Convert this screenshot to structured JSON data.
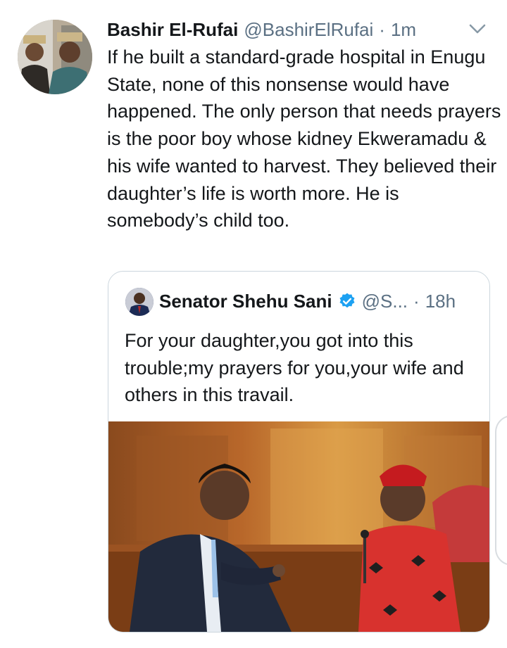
{
  "tweet": {
    "author_name": "Bashir El-Rufai",
    "author_handle": "@BashirElRufai",
    "separator": "·",
    "time": "1m",
    "text": "If he built a standard-grade hospital in Enugu State, none of this nonsense would have happened. The only person that needs prayers is the poor boy whose kidney Ekweramadu & his wife wanted to harvest. They believed their daughter’s life is worth more. He is somebody’s child too.",
    "menu_icon": "chevron-down-icon"
  },
  "quoted_tweet": {
    "author_name": "Senator Shehu Sani",
    "verified_icon": "verified-badge-icon",
    "author_handle": "@S...",
    "separator": "·",
    "time": "18h",
    "text": "For your daughter,you got into this trouble;my prayers for you,your wife and others in this travail."
  },
  "colors": {
    "text": "#14171a",
    "muted": "#5b7083",
    "verified": "#1da1f2",
    "border": "#ccd6dd"
  }
}
